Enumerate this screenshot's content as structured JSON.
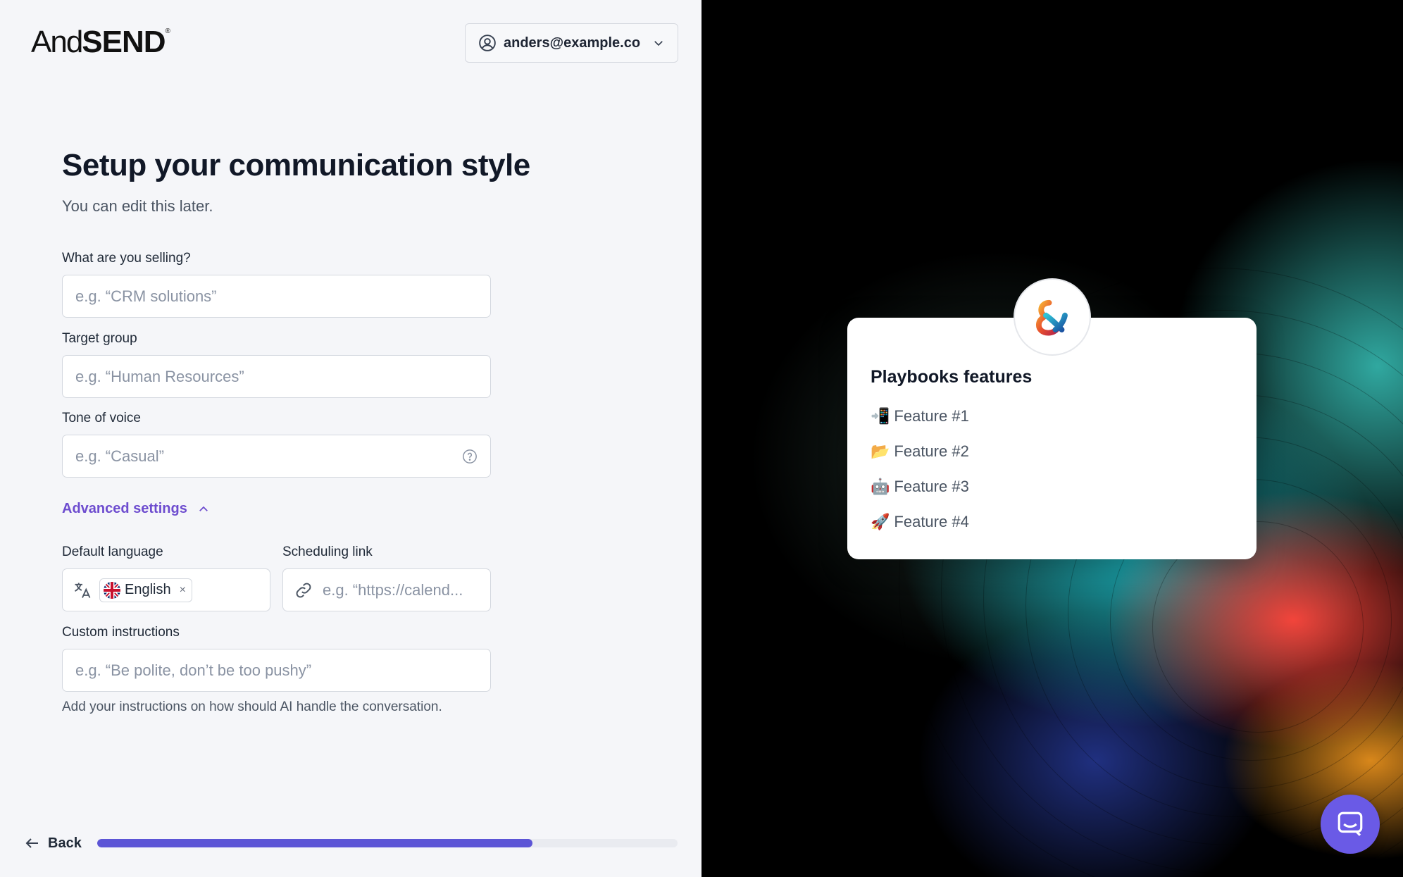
{
  "brand": {
    "name_light": "And",
    "name_bold": "SEND",
    "registered": "®"
  },
  "account": {
    "email": "anders@example.co"
  },
  "header": {
    "title": "Setup your communication style",
    "subtitle": "You can edit this later."
  },
  "form": {
    "selling": {
      "label": "What are you selling?",
      "placeholder": "e.g. “CRM solutions”"
    },
    "target": {
      "label": "Target group",
      "placeholder": "e.g. “Human Resources”"
    },
    "tone": {
      "label": "Tone of voice",
      "placeholder": "e.g. “Casual”"
    },
    "advanced_label": "Advanced settings",
    "language": {
      "label": "Default language",
      "value": "English",
      "remove": "×"
    },
    "scheduling": {
      "label": "Scheduling link",
      "placeholder": "e.g. “https://calend..."
    },
    "custom": {
      "label": "Custom instructions",
      "placeholder": "e.g. “Be polite, don’t be too pushy”",
      "hint": "Add your instructions on how should AI handle the conversation."
    }
  },
  "footer": {
    "back_label": "Back",
    "progress": 0.75
  },
  "card": {
    "title": "Playbooks features",
    "features": [
      {
        "emoji": "📲",
        "label": "Feature #1"
      },
      {
        "emoji": "📂",
        "label": "Feature #2"
      },
      {
        "emoji": "🤖",
        "label": "Feature #3"
      },
      {
        "emoji": "🚀",
        "label": "Feature #4"
      }
    ]
  },
  "colors": {
    "accent": "#6d4ccf",
    "progress": "#5c55d6",
    "chat": "#6a5ae6"
  },
  "icons": [
    "user-circle-icon",
    "chevron-down-icon",
    "help-circle-icon",
    "chevron-up-icon",
    "translate-icon",
    "uk-flag-icon",
    "link-icon",
    "arrow-left-icon",
    "brand-ampersand-icon",
    "chat-icon"
  ]
}
